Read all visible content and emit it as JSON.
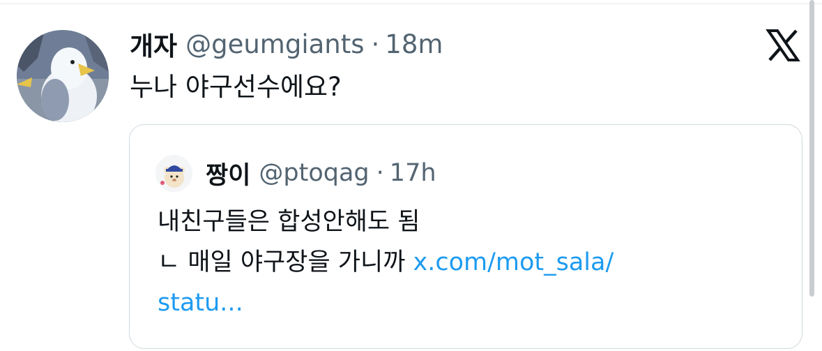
{
  "tweet": {
    "display_name": "개자",
    "handle": "@geumgiants",
    "separator": "·",
    "time": "18m",
    "text": "누나 야구선수에요?"
  },
  "quote": {
    "display_name": "짱이",
    "handle": "@ptoqag",
    "separator": "·",
    "time": "17h",
    "line1": "내친구들은 합성안해도 됨",
    "line2": "ㄴ 매일 야구장을 가니까 ",
    "link_start": "x.com/mot_sala/",
    "link_end": "statu..."
  },
  "icons": {
    "platform_logo": "x-logo-icon",
    "avatar": "seagull-avatar",
    "quote_avatar": "bear-mascot-avatar"
  },
  "colors": {
    "text": "#0f1419",
    "secondary": "#536471",
    "link": "#1d9bf0",
    "border": "#cfd9de"
  }
}
